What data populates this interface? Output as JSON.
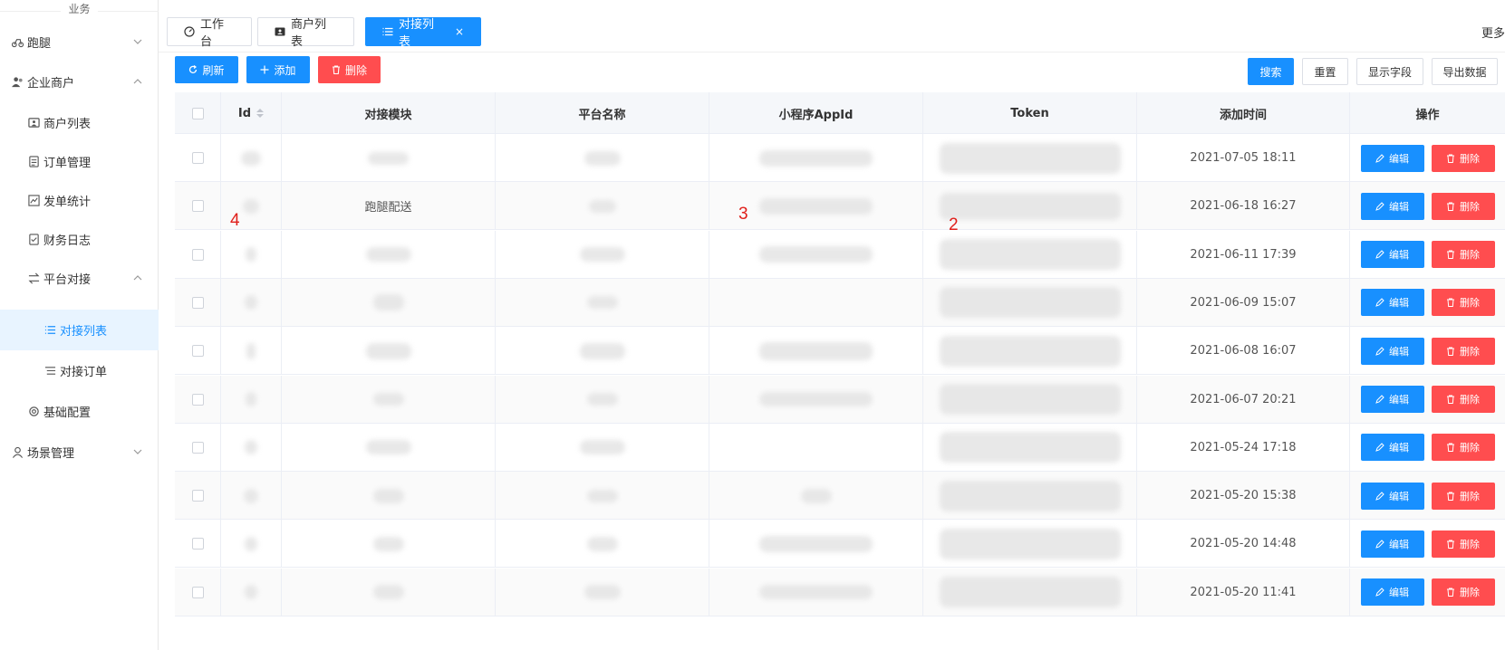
{
  "sidebar": {
    "section": "业务",
    "items": [
      {
        "label": "跑腿",
        "icon": "motorcycle-icon"
      },
      {
        "label": "企业商户",
        "icon": "users-icon"
      },
      {
        "label": "商户列表",
        "icon": "id-card-icon"
      },
      {
        "label": "订单管理",
        "icon": "document-icon"
      },
      {
        "label": "发单统计",
        "icon": "chart-icon"
      },
      {
        "label": "财务日志",
        "icon": "checklist-icon"
      },
      {
        "label": "平台对接",
        "icon": "swap-icon"
      },
      {
        "label": "对接列表",
        "icon": "list-icon"
      },
      {
        "label": "对接订单",
        "icon": "lines-icon"
      },
      {
        "label": "基础配置",
        "icon": "gear-icon"
      },
      {
        "label": "场景管理",
        "icon": "user-icon"
      }
    ]
  },
  "tabs": [
    {
      "label": "工作台"
    },
    {
      "label": "商户列表"
    },
    {
      "label": "对接列表",
      "close": "×"
    }
  ],
  "more": "更多",
  "toolbar": {
    "refresh": "刷新",
    "add": "添加",
    "delete": "删除",
    "search": "搜索",
    "reset": "重置",
    "show_fields": "显示字段",
    "export": "导出数据"
  },
  "table": {
    "headers": [
      "Id",
      "对接模块",
      "平台名称",
      "小程序AppId",
      "Token",
      "添加时间",
      "操作"
    ],
    "edit_label": "编辑",
    "delete_label": "删除",
    "rows": [
      {
        "module": "",
        "time": "2021-07-05 18:11"
      },
      {
        "module": "跑腿配送",
        "time": "2021-06-18 16:27"
      },
      {
        "module": "",
        "time": "2021-06-11 17:39"
      },
      {
        "module": "",
        "time": "2021-06-09 15:07"
      },
      {
        "module": "",
        "time": "2021-06-08 16:07"
      },
      {
        "module": "",
        "time": "2021-06-07 20:21"
      },
      {
        "module": "",
        "time": "2021-05-24 17:18"
      },
      {
        "module": "",
        "time": "2021-05-20 15:38"
      },
      {
        "module": "",
        "time": "2021-05-20 14:48"
      },
      {
        "module": "",
        "time": "2021-05-20 11:41"
      }
    ]
  },
  "annotations": {
    "a4": "4",
    "a3": "3",
    "a2": "2"
  },
  "colors": {
    "primary": "#1890ff",
    "danger": "#ff4d4f",
    "active_bg": "#e8f4ff"
  }
}
